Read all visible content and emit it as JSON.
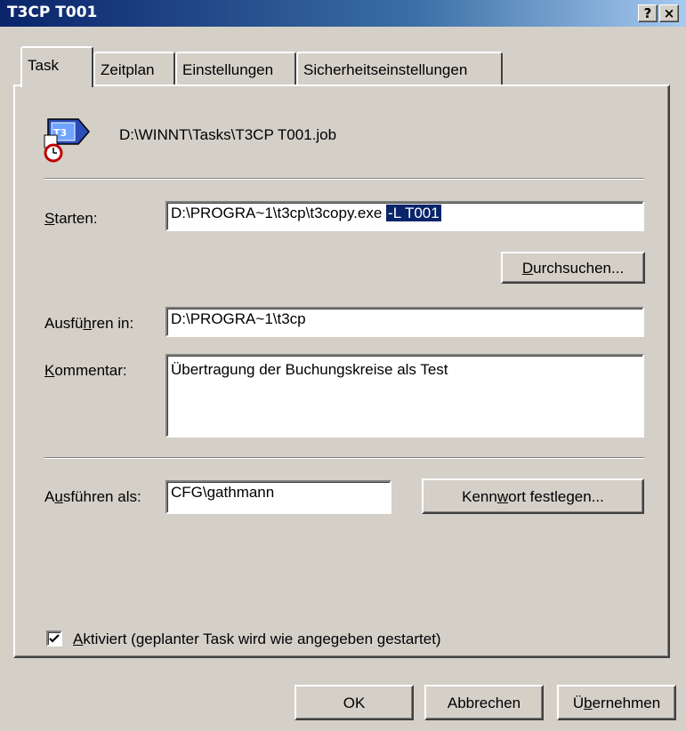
{
  "window": {
    "title": "T3CP T001",
    "help_button": "?",
    "close_button": "×"
  },
  "tabs": [
    {
      "label": "Task",
      "active": true
    },
    {
      "label": "Zeitplan",
      "active": false
    },
    {
      "label": "Einstellungen",
      "active": false
    },
    {
      "label": "Sicherheitseinstellungen",
      "active": false
    }
  ],
  "task": {
    "file_path": "D:\\WINNT\\Tasks\\T3CP T001.job",
    "icon": "scheduled-task-app-icon",
    "run": {
      "label_accel": "S",
      "label_rest": "tarten:",
      "value": "D:\\PROGRA~1\\t3cp\\t3copy.exe ",
      "selected": "-L T001"
    },
    "browse_button": {
      "accel": "D",
      "rest": "urchsuchen..."
    },
    "start_in": {
      "label_pre": "Ausfü",
      "label_accel": "h",
      "label_post": "ren in:",
      "value": "D:\\PROGRA~1\\t3cp"
    },
    "comment": {
      "label_accel": "K",
      "label_rest": "ommentar:",
      "value": "Übertragung der Buchungskreise als Test"
    },
    "run_as": {
      "label_pre": "A",
      "label_accel": "u",
      "label_post": "sführen als:",
      "value": "CFG\\gathmann"
    },
    "set_password_button": {
      "pre": "Kenn",
      "accel": "w",
      "post": "ort festlegen..."
    },
    "enabled": {
      "checked": true,
      "label_accel": "A",
      "label_rest": "ktiviert (geplanter Task wird wie angegeben gestartet)"
    }
  },
  "footer": {
    "ok": "OK",
    "cancel": "Abbrechen",
    "apply": {
      "pre": "Ü",
      "accel": "b",
      "post": "ernehmen"
    }
  },
  "colors": {
    "title_bar_start": "#0a246a",
    "title_bar_end": "#a6caf0",
    "face": "#d4d0c8",
    "selection": "#0a246a"
  }
}
